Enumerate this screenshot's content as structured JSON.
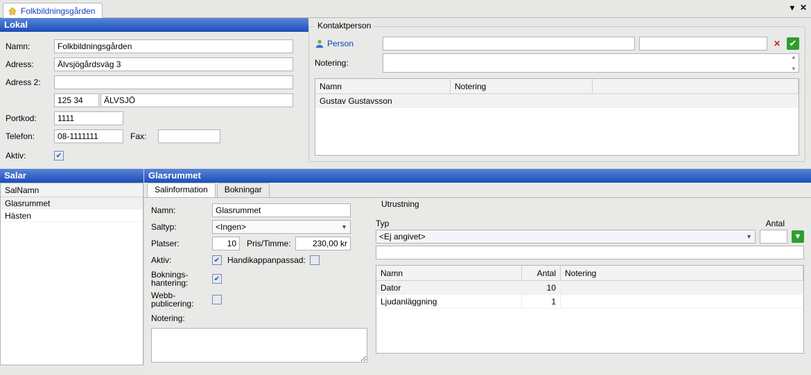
{
  "tab": {
    "title": "Folkbildningsgården"
  },
  "lokal": {
    "header": "Lokal",
    "namn_label": "Namn:",
    "namn": "Folkbildningsgården",
    "adress_label": "Adress:",
    "adress": "Älvsjögårdsväg 3",
    "adress2_label": "Adress 2:",
    "adress2": "",
    "zip": "125 34",
    "city": "ÄLVSJÖ",
    "portkod_label": "Portkod:",
    "portkod": "1111",
    "telefon_label": "Telefon:",
    "telefon": "08-1111111",
    "fax_label": "Fax:",
    "fax": "",
    "aktiv_label": "Aktiv:",
    "aktiv_checked": true
  },
  "kontakt": {
    "legend": "Kontaktperson",
    "person_label": "Person",
    "person1": "",
    "person2": "",
    "notering_label": "Notering:",
    "notering": "",
    "grid": {
      "headers": [
        "Namn",
        "Notering",
        ""
      ],
      "rows": [
        {
          "namn": "Gustav Gustavsson",
          "notering": "",
          "x": ""
        }
      ]
    }
  },
  "salar": {
    "header": "Salar",
    "col": "SalNamn",
    "items": [
      "Glasrummet",
      "Hästen"
    ],
    "selected": 0
  },
  "glas": {
    "header": "Glasrummet",
    "tabs": [
      "Salinformation",
      "Bokningar"
    ],
    "active_tab": 0,
    "namn_label": "Namn:",
    "namn": "Glasrummet",
    "saltyp_label": "Saltyp:",
    "saltyp": "<Ingen>",
    "platser_label": "Platser:",
    "platser": "10",
    "pris_label": "Pris/Timme:",
    "pris": "230,00 kr",
    "aktiv_label": "Aktiv:",
    "aktiv_checked": true,
    "handi_label": "Handikappanpassad:",
    "handi_checked": false,
    "bokn_label": "Boknings-\nhantering:",
    "bokn_checked": true,
    "webb_label": "Webb-\npublicering:",
    "webb_checked": false,
    "notering_label": "Notering:",
    "notering": ""
  },
  "utrustning": {
    "legend": "Utrustning",
    "typ_label": "Typ",
    "typ_sel": "<Ej angivet>",
    "antal_label": "Antal",
    "antal": "",
    "filter": "",
    "grid": {
      "headers": [
        "Namn",
        "Antal",
        "Notering"
      ],
      "rows": [
        {
          "namn": "Dator",
          "antal": "10",
          "notering": ""
        },
        {
          "namn": "Ljudanläggning",
          "antal": "1",
          "notering": ""
        }
      ]
    }
  }
}
